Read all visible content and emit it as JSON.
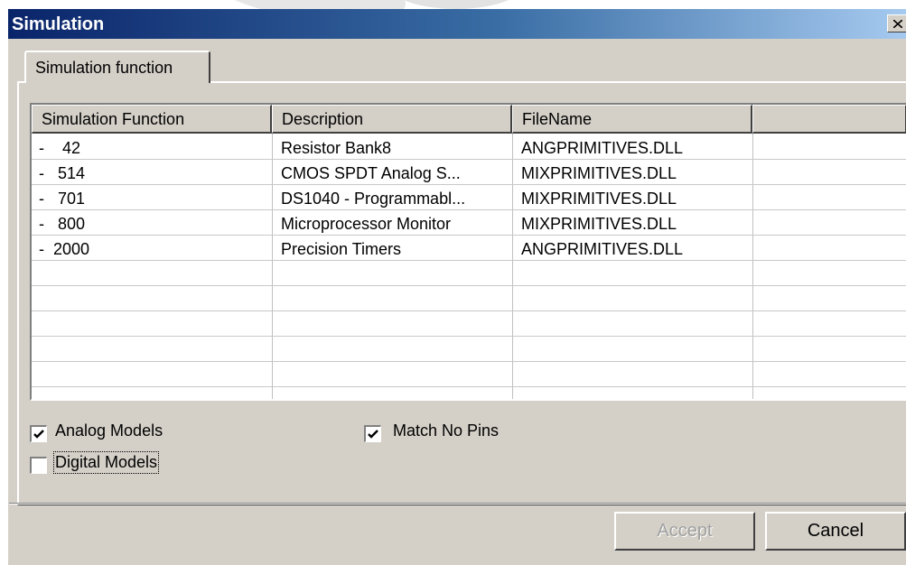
{
  "window": {
    "title": "Simulation"
  },
  "tabs": [
    {
      "label": "Simulation function"
    }
  ],
  "list": {
    "columns": [
      "Simulation Function",
      "Description",
      "FileName",
      ""
    ],
    "rows": [
      {
        "id": "-    42",
        "description": "Resistor Bank8",
        "file": "ANGPRIMITIVES.DLL"
      },
      {
        "id": "-   514",
        "description": "CMOS SPDT Analog S...",
        "file": "MIXPRIMITIVES.DLL"
      },
      {
        "id": "-   701",
        "description": "DS1040 - Programmabl...",
        "file": "MIXPRIMITIVES.DLL"
      },
      {
        "id": "-   800",
        "description": "Microprocessor Monitor",
        "file": "MIXPRIMITIVES.DLL"
      },
      {
        "id": "-  2000",
        "description": "Precision Timers",
        "file": "ANGPRIMITIVES.DLL"
      }
    ]
  },
  "options": {
    "analog_models": {
      "label": "Analog Models",
      "checked": true
    },
    "digital_models": {
      "label": "Digital Models",
      "checked": false
    },
    "match_no_pins": {
      "label": "Match No Pins",
      "checked": true
    }
  },
  "buttons": {
    "accept": "Accept",
    "cancel": "Cancel"
  },
  "icons": {
    "close": "close-icon",
    "check": "checkmark-icon"
  }
}
